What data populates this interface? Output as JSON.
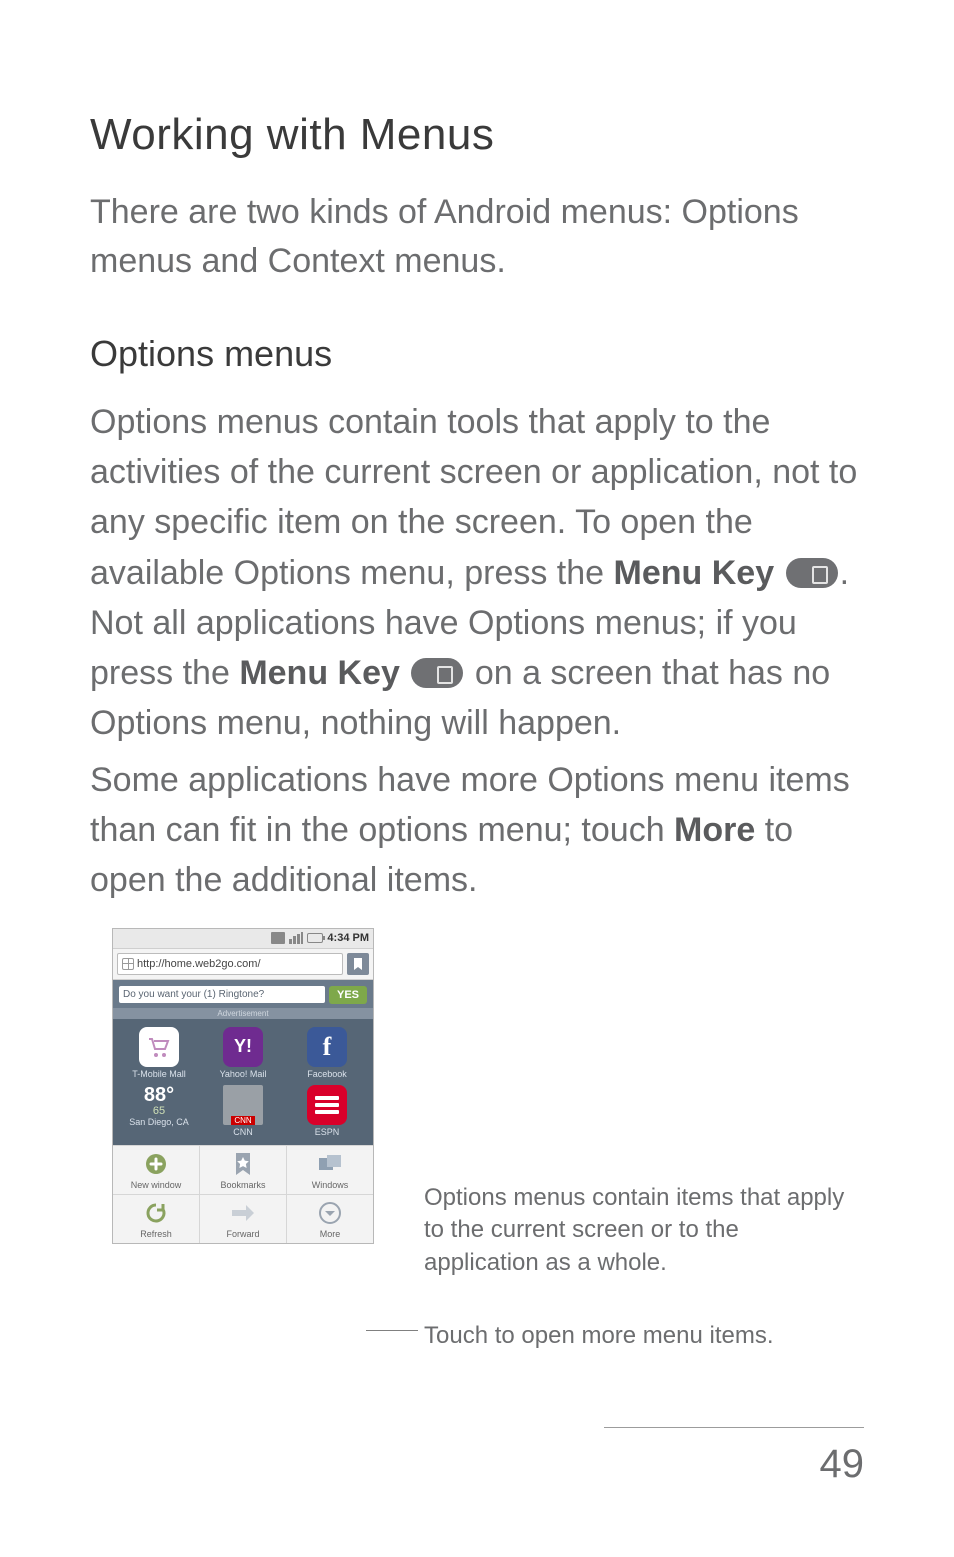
{
  "heading": "Working with Menus",
  "intro": "There are two kinds of Android menus: Options menus and Context menus.",
  "sub": "Options menus",
  "para1_a": "Options menus contain tools that apply to the activities of the current screen or application, not to any specific item on the screen. To open the available Options menu, press the ",
  "menu_key": "Menu Key",
  "para1_b": ". Not all applications have Options menus; if you press the ",
  "para1_c": " on a screen that has no Options menu, nothing will happen.",
  "para2_a": "Some applications have more Options menu items than can fit in the options menu; touch ",
  "more": "More",
  "para2_b": " to open the additional items.",
  "status_time": "4:34 PM",
  "url": "http://home.web2go.com/",
  "promo_text": "Do you want your (1) Ringtone?",
  "promo_yes": "YES",
  "promo_ad": "Advertisement",
  "tiles": {
    "tmall": "T-Mobile Mall",
    "yahoo": "Yahoo! Mail",
    "fb": "Facebook",
    "temp_hi": "88°",
    "temp_lo": "65",
    "city": "San Diego, CA",
    "cnn": "CNN",
    "espn": "ESPN"
  },
  "menu": {
    "new": "New window",
    "bookmarks": "Bookmarks",
    "windows": "Windows",
    "refresh": "Refresh",
    "forward": "Forward",
    "more": "More"
  },
  "callout1": "Options menus contain items that apply to the current screen or to the application as a whole.",
  "callout2": "Touch to open more menu items.",
  "page_number": "49"
}
